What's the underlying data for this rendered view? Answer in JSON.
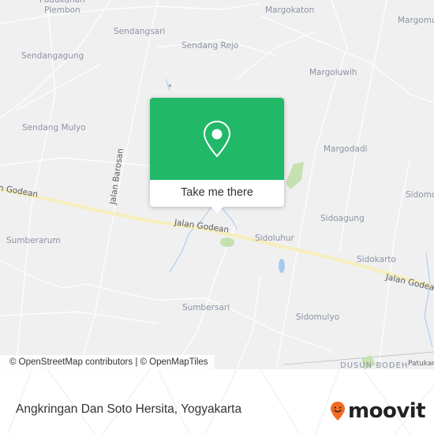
{
  "map": {
    "places": [
      {
        "name": "Padukuhan Plembon",
        "lines": [
          "Padukuhan",
          "Plembon"
        ]
      },
      {
        "name": "Sendangsari"
      },
      {
        "name": "Margokaton"
      },
      {
        "name": "Margomulyo",
        "display": "Margomu"
      },
      {
        "name": "Sendangagung"
      },
      {
        "name": "Sendang Rejo"
      },
      {
        "name": "Margoluwih"
      },
      {
        "name": "Sendang Mulyo"
      },
      {
        "name": "Margodadi"
      },
      {
        "name": "Sidomoyo",
        "display": "Sidomo"
      },
      {
        "name": "Sidoagung"
      },
      {
        "name": "Sumberarum"
      },
      {
        "name": "Sidoluhur"
      },
      {
        "name": "Sidokarto"
      },
      {
        "name": "Sumbersari"
      },
      {
        "name": "Sidomulyo"
      },
      {
        "name": "Patukan"
      },
      {
        "name": "Dusun Bodeh",
        "display": "DUSUN BODEH"
      }
    ],
    "roads": [
      {
        "name": "Jalan Godean",
        "display": "n Godean"
      },
      {
        "name": "Jalan Barosan"
      },
      {
        "name": "Jalan Godean",
        "display": "Jalan Godean"
      },
      {
        "name": "Jalan Godean",
        "display": "Jalan Godean"
      }
    ],
    "colors": {
      "background": "#f0f0f1",
      "major_road": "#f6eebf",
      "water": "#a9c8ee",
      "park": "#c6e0b0"
    }
  },
  "popup": {
    "icon": "map-pin-icon",
    "cta_label": "Take me there",
    "color": "#21b868"
  },
  "attribution": "© OpenStreetMap contributors | © OpenMapTiles",
  "footer": {
    "title": "Angkringan Dan Soto Hersita, Yogyakarta",
    "logo_text": "moovit",
    "logo_color": "#f26b23"
  }
}
